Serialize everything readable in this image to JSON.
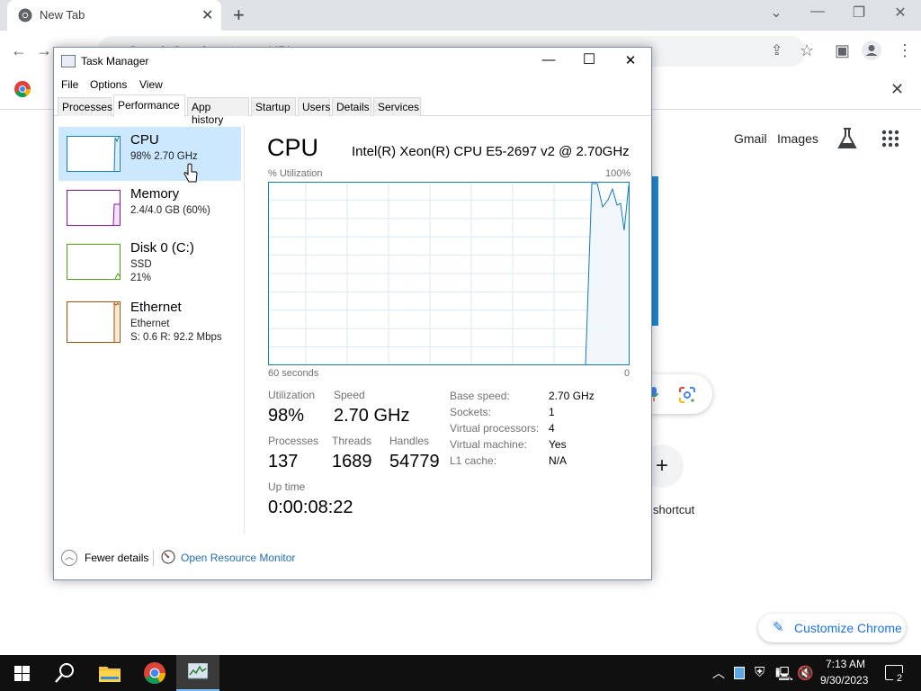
{
  "browser": {
    "tab_title": "New Tab",
    "tab_close": "✕",
    "new_tab": "+",
    "omnibox_placeholder": "Search Google or type a URL",
    "window_controls": {
      "chevron": "⌄",
      "minimize": "—",
      "restore": "❐",
      "close": "✕"
    },
    "infobar_close": "✕",
    "ntp": {
      "gmail": "Gmail",
      "images": "Images",
      "shortcut_plus": "+",
      "shortcut_label": "shortcut",
      "customize": "Customize Chrome",
      "pencil": "✎"
    }
  },
  "task_manager": {
    "title": "Task Manager",
    "window_buttons": {
      "minimize": "—",
      "maximize": "☐",
      "close": "✕"
    },
    "menu": [
      "File",
      "Options",
      "View"
    ],
    "tabs": [
      "Processes",
      "Performance",
      "App history",
      "Startup",
      "Users",
      "Details",
      "Services"
    ],
    "active_tab": "Performance",
    "resources": [
      {
        "name": "CPU",
        "line1": "98%  2.70 GHz",
        "line2": "",
        "color": "#117dbb"
      },
      {
        "name": "Memory",
        "line1": "2.4/4.0 GB (60%)",
        "line2": "",
        "color": "#8b12ae"
      },
      {
        "name": "Disk 0 (C:)",
        "line1": "SSD",
        "line2": "21%",
        "color": "#4da60c"
      },
      {
        "name": "Ethernet",
        "line1": "Ethernet",
        "line2": "S: 0.6  R: 92.2 Mbps",
        "color": "#a74f01"
      }
    ],
    "cpu": {
      "heading": "CPU",
      "model": "Intel(R) Xeon(R) CPU E5-2697 v2 @ 2.70GHz",
      "graph_label": "% Utilization",
      "graph_max": "100%",
      "graph_time": "60 seconds",
      "graph_min": "0",
      "stats": {
        "utilization_label": "Utilization",
        "utilization": "98%",
        "speed_label": "Speed",
        "speed": "2.70 GHz",
        "processes_label": "Processes",
        "processes": "137",
        "threads_label": "Threads",
        "threads": "1689",
        "handles_label": "Handles",
        "handles": "54779",
        "uptime_label": "Up time",
        "uptime": "0:00:08:22"
      },
      "info": [
        {
          "key": "Base speed:",
          "value": "2.70 GHz"
        },
        {
          "key": "Sockets:",
          "value": "1"
        },
        {
          "key": "Virtual processors:",
          "value": "4"
        },
        {
          "key": "Virtual machine:",
          "value": "Yes"
        },
        {
          "key": "L1 cache:",
          "value": "N/A"
        }
      ]
    },
    "footer": {
      "fewer_details": "Fewer details",
      "resource_monitor": "Open Resource Monitor"
    }
  },
  "taskbar": {
    "time": "7:13 AM",
    "date": "9/30/2023",
    "notification_count": "2"
  }
}
